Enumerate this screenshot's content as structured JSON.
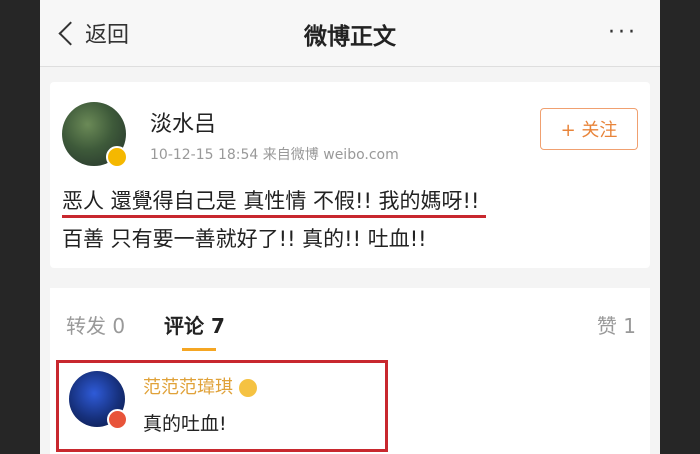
{
  "nav": {
    "back_label": "返回",
    "title": "微博正文",
    "more_label": "···"
  },
  "post": {
    "author": "淡水吕",
    "meta": "10-12-15 18:54  来自微博 weibo.com",
    "follow_label": "+ 关注",
    "text_line1": "恶人 還覺得自己是 真性情  不假!! 我的媽呀!!",
    "text_line2": "百善  只有要一善就好了!! 真的!! 吐血!!"
  },
  "tabs": {
    "repost": "转发 0",
    "comments": "评论 7",
    "likes": "赞 1"
  },
  "comment": {
    "author": "范范范瑋琪",
    "text": "真的吐血!"
  },
  "colors": {
    "highlight_red": "#c8282e",
    "follow_orange": "#e8843a",
    "tab_indicator": "#f5a623"
  }
}
